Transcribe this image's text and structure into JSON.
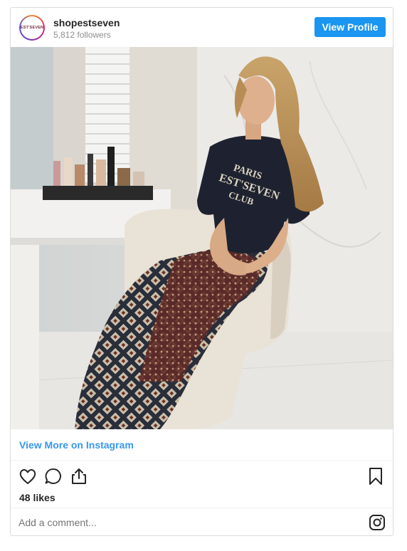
{
  "profile": {
    "username": "shopestseven",
    "followers": "5,812 followers",
    "avatar_text": "EST'SEVEN",
    "view_profile_label": "View Profile"
  },
  "post": {
    "image_icon": "photo-woman-seated-armchair",
    "tshirt_text": [
      "PARIS",
      "EST'SEVEN",
      "CLUB"
    ]
  },
  "view_more_label": "View More on Instagram",
  "actions": {
    "like_icon": "heart-icon",
    "comment_icon": "comment-icon",
    "share_icon": "share-icon",
    "save_icon": "bookmark-icon"
  },
  "likes": "48 likes",
  "comment": {
    "placeholder": "Add a comment..."
  },
  "colors": {
    "accent": "#3897f0",
    "button": "#1a95f0",
    "muted": "#8e8e8e"
  }
}
